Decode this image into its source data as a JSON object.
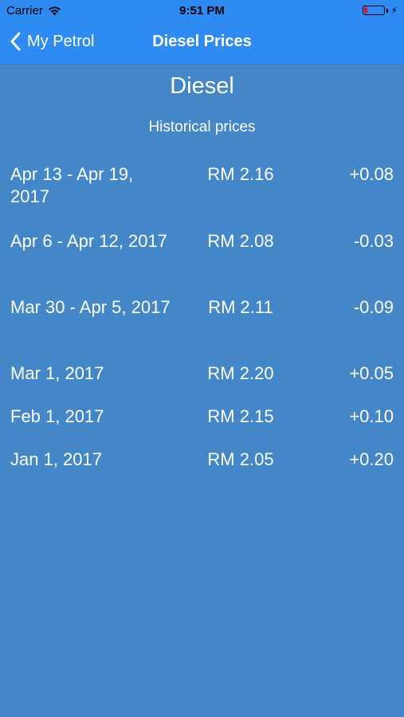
{
  "status_bar": {
    "carrier": "Carrier",
    "time": "9:51 PM",
    "battery_level_fraction": 0.15,
    "battery_color": "#e0161e"
  },
  "nav": {
    "back_label": "My Petrol",
    "title": "Diesel Prices",
    "bar_color": "#2e8bf2"
  },
  "main": {
    "title": "Diesel",
    "subtitle": "Historical prices",
    "background_color": "#4387c8",
    "rows": [
      {
        "date": "Apr 13 - Apr 19, 2017",
        "price": "RM 2.16",
        "change": "+0.08"
      },
      {
        "date": "Apr 6 - Apr 12, 2017",
        "price": "RM 2.08",
        "change": "-0.03"
      },
      {
        "date": "Mar 30 - Apr 5, 2017",
        "price": "RM 2.11",
        "change": "-0.09"
      },
      {
        "date": "Mar 1, 2017",
        "price": "RM 2.20",
        "change": "+0.05"
      },
      {
        "date": "Feb 1, 2017",
        "price": "RM 2.15",
        "change": "+0.10"
      },
      {
        "date": "Jan 1, 2017",
        "price": "RM 2.05",
        "change": "+0.20"
      }
    ]
  }
}
